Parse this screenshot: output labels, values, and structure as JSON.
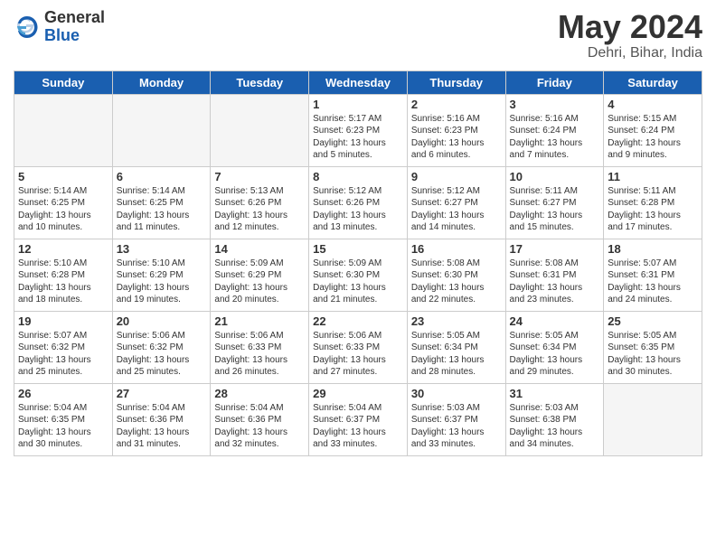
{
  "logo": {
    "general": "General",
    "blue": "Blue"
  },
  "title": {
    "month_year": "May 2024",
    "location": "Dehri, Bihar, India"
  },
  "days_of_week": [
    "Sunday",
    "Monday",
    "Tuesday",
    "Wednesday",
    "Thursday",
    "Friday",
    "Saturday"
  ],
  "weeks": [
    [
      {
        "day": "",
        "info": ""
      },
      {
        "day": "",
        "info": ""
      },
      {
        "day": "",
        "info": ""
      },
      {
        "day": "1",
        "info": "Sunrise: 5:17 AM\nSunset: 6:23 PM\nDaylight: 13 hours\nand 5 minutes."
      },
      {
        "day": "2",
        "info": "Sunrise: 5:16 AM\nSunset: 6:23 PM\nDaylight: 13 hours\nand 6 minutes."
      },
      {
        "day": "3",
        "info": "Sunrise: 5:16 AM\nSunset: 6:24 PM\nDaylight: 13 hours\nand 7 minutes."
      },
      {
        "day": "4",
        "info": "Sunrise: 5:15 AM\nSunset: 6:24 PM\nDaylight: 13 hours\nand 9 minutes."
      }
    ],
    [
      {
        "day": "5",
        "info": "Sunrise: 5:14 AM\nSunset: 6:25 PM\nDaylight: 13 hours\nand 10 minutes."
      },
      {
        "day": "6",
        "info": "Sunrise: 5:14 AM\nSunset: 6:25 PM\nDaylight: 13 hours\nand 11 minutes."
      },
      {
        "day": "7",
        "info": "Sunrise: 5:13 AM\nSunset: 6:26 PM\nDaylight: 13 hours\nand 12 minutes."
      },
      {
        "day": "8",
        "info": "Sunrise: 5:12 AM\nSunset: 6:26 PM\nDaylight: 13 hours\nand 13 minutes."
      },
      {
        "day": "9",
        "info": "Sunrise: 5:12 AM\nSunset: 6:27 PM\nDaylight: 13 hours\nand 14 minutes."
      },
      {
        "day": "10",
        "info": "Sunrise: 5:11 AM\nSunset: 6:27 PM\nDaylight: 13 hours\nand 15 minutes."
      },
      {
        "day": "11",
        "info": "Sunrise: 5:11 AM\nSunset: 6:28 PM\nDaylight: 13 hours\nand 17 minutes."
      }
    ],
    [
      {
        "day": "12",
        "info": "Sunrise: 5:10 AM\nSunset: 6:28 PM\nDaylight: 13 hours\nand 18 minutes."
      },
      {
        "day": "13",
        "info": "Sunrise: 5:10 AM\nSunset: 6:29 PM\nDaylight: 13 hours\nand 19 minutes."
      },
      {
        "day": "14",
        "info": "Sunrise: 5:09 AM\nSunset: 6:29 PM\nDaylight: 13 hours\nand 20 minutes."
      },
      {
        "day": "15",
        "info": "Sunrise: 5:09 AM\nSunset: 6:30 PM\nDaylight: 13 hours\nand 21 minutes."
      },
      {
        "day": "16",
        "info": "Sunrise: 5:08 AM\nSunset: 6:30 PM\nDaylight: 13 hours\nand 22 minutes."
      },
      {
        "day": "17",
        "info": "Sunrise: 5:08 AM\nSunset: 6:31 PM\nDaylight: 13 hours\nand 23 minutes."
      },
      {
        "day": "18",
        "info": "Sunrise: 5:07 AM\nSunset: 6:31 PM\nDaylight: 13 hours\nand 24 minutes."
      }
    ],
    [
      {
        "day": "19",
        "info": "Sunrise: 5:07 AM\nSunset: 6:32 PM\nDaylight: 13 hours\nand 25 minutes."
      },
      {
        "day": "20",
        "info": "Sunrise: 5:06 AM\nSunset: 6:32 PM\nDaylight: 13 hours\nand 25 minutes."
      },
      {
        "day": "21",
        "info": "Sunrise: 5:06 AM\nSunset: 6:33 PM\nDaylight: 13 hours\nand 26 minutes."
      },
      {
        "day": "22",
        "info": "Sunrise: 5:06 AM\nSunset: 6:33 PM\nDaylight: 13 hours\nand 27 minutes."
      },
      {
        "day": "23",
        "info": "Sunrise: 5:05 AM\nSunset: 6:34 PM\nDaylight: 13 hours\nand 28 minutes."
      },
      {
        "day": "24",
        "info": "Sunrise: 5:05 AM\nSunset: 6:34 PM\nDaylight: 13 hours\nand 29 minutes."
      },
      {
        "day": "25",
        "info": "Sunrise: 5:05 AM\nSunset: 6:35 PM\nDaylight: 13 hours\nand 30 minutes."
      }
    ],
    [
      {
        "day": "26",
        "info": "Sunrise: 5:04 AM\nSunset: 6:35 PM\nDaylight: 13 hours\nand 30 minutes."
      },
      {
        "day": "27",
        "info": "Sunrise: 5:04 AM\nSunset: 6:36 PM\nDaylight: 13 hours\nand 31 minutes."
      },
      {
        "day": "28",
        "info": "Sunrise: 5:04 AM\nSunset: 6:36 PM\nDaylight: 13 hours\nand 32 minutes."
      },
      {
        "day": "29",
        "info": "Sunrise: 5:04 AM\nSunset: 6:37 PM\nDaylight: 13 hours\nand 33 minutes."
      },
      {
        "day": "30",
        "info": "Sunrise: 5:03 AM\nSunset: 6:37 PM\nDaylight: 13 hours\nand 33 minutes."
      },
      {
        "day": "31",
        "info": "Sunrise: 5:03 AM\nSunset: 6:38 PM\nDaylight: 13 hours\nand 34 minutes."
      },
      {
        "day": "",
        "info": ""
      }
    ]
  ]
}
